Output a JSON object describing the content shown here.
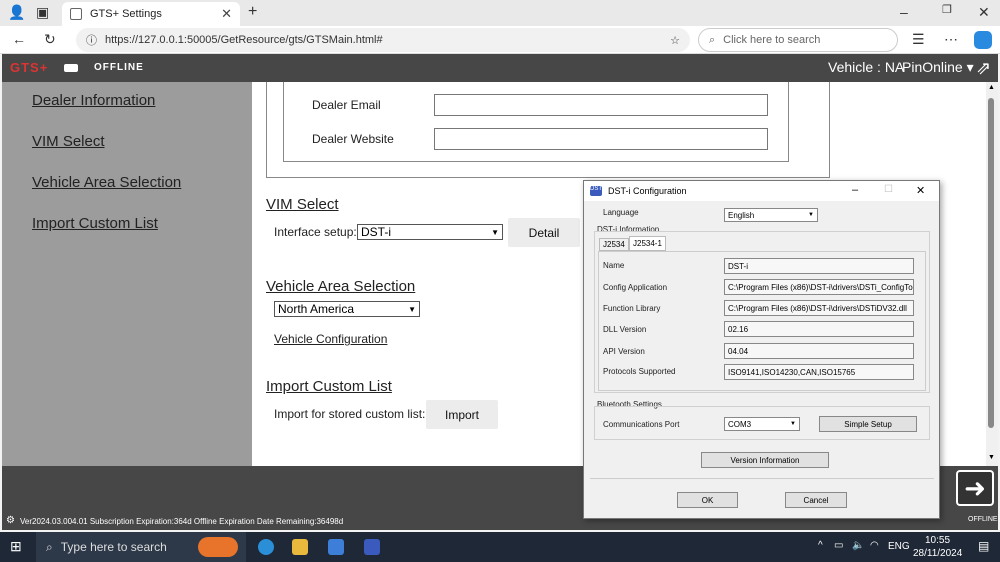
{
  "browser": {
    "tab_title": "GTS+ Settings",
    "url": "https://127.0.0.1:50005/GetResource/gts/GTSMain.html#",
    "search_placeholder": "Click here to search"
  },
  "header": {
    "logo": "GTS+",
    "offline": "OFFLINE",
    "vehicle": "Vehicle : NA",
    "pin": "PinOnline ▾"
  },
  "sidebar": {
    "items": [
      {
        "label": "Dealer Information"
      },
      {
        "label": "VIM Select"
      },
      {
        "label": "Vehicle Area Selection"
      },
      {
        "label": "Import Custom List"
      }
    ]
  },
  "main": {
    "dealer_email_label": "Dealer Email",
    "dealer_website_label": "Dealer Website",
    "dealer_email_value": "",
    "dealer_website_value": "",
    "vim_title": "VIM Select",
    "interface_label": "Interface setup:",
    "interface_value": "DST-i",
    "detail_button": "Detail",
    "area_title": "Vehicle Area Selection",
    "area_value": "North America",
    "vehicle_config_link": "Vehicle Configuration",
    "import_title": "Import Custom List",
    "import_label": "Import for stored custom list:",
    "import_button": "Import"
  },
  "status": {
    "text": "Ver2024.03.004.01   Subscription Expiration:364d   Offline Expiration Date Remaining:36498d",
    "offline_badge": "OFFLINE"
  },
  "dialog": {
    "title": "DST-i Configuration",
    "language_label": "Language",
    "language_value": "English",
    "info_group": "DST-i Information",
    "tabs": [
      "J2534",
      "J2534-1"
    ],
    "fields": [
      {
        "label": "Name",
        "value": "DST-i"
      },
      {
        "label": "Config Application",
        "value": "C:\\Program Files (x86)\\DST-i\\drivers\\DSTi_ConfigToo"
      },
      {
        "label": "Function Library",
        "value": "C:\\Program Files (x86)\\DST-i\\drivers\\DSTiDV32.dll"
      },
      {
        "label": "DLL Version",
        "value": "02.16"
      },
      {
        "label": "API Version",
        "value": "04.04"
      },
      {
        "label": "Protocols Supported",
        "value": "ISO9141,ISO14230,CAN,ISO15765"
      }
    ],
    "bt_group": "Bluetooth Settings",
    "comm_port_label": "Communications Port",
    "comm_port_value": "COM3",
    "simple_setup": "Simple Setup",
    "version_info": "Version Information",
    "ok": "OK",
    "cancel": "Cancel"
  },
  "taskbar": {
    "search": "Type here to search",
    "lang": "ENG",
    "time": "10:55",
    "date": "28/11/2024"
  }
}
